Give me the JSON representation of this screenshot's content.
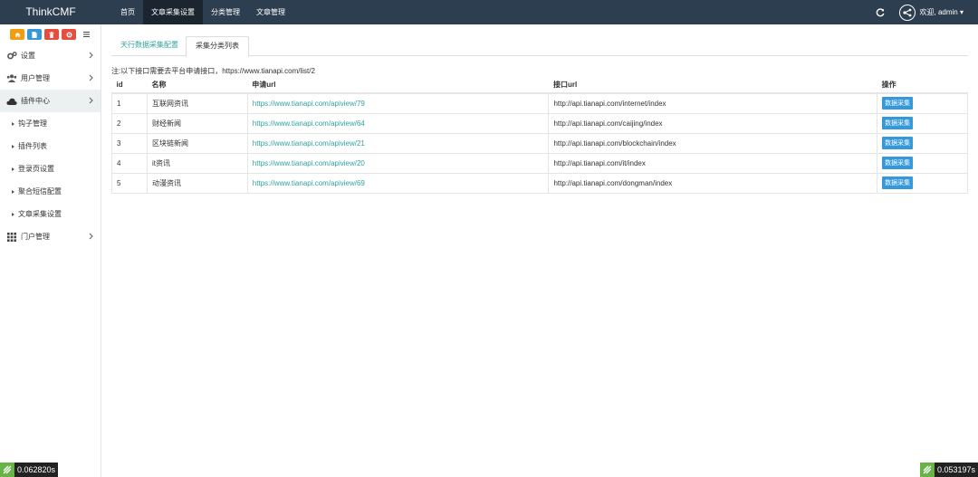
{
  "brand": "ThinkCMF",
  "topnav": [
    {
      "label": "首页"
    },
    {
      "label": "文章采集设置"
    },
    {
      "label": "分类管理"
    },
    {
      "label": "文章管理"
    }
  ],
  "user": {
    "label": "欢迎, admin ▾"
  },
  "sidebar": {
    "menu": [
      {
        "label": "设置",
        "icon": "gears-icon"
      },
      {
        "label": "用户管理",
        "icon": "users-icon"
      },
      {
        "label": "插件中心",
        "icon": "cloud-icon"
      }
    ],
    "submenu": [
      {
        "label": "钩子管理"
      },
      {
        "label": "插件列表"
      },
      {
        "label": "登录页设置"
      },
      {
        "label": "聚合短信配置"
      },
      {
        "label": "文章采集设置"
      }
    ],
    "portal": {
      "label": "门户管理",
      "icon": "grid-icon"
    }
  },
  "tabs": [
    {
      "label": "天行数据采集配置"
    },
    {
      "label": "采集分类列表"
    }
  ],
  "note": "注:以下接口需要去平台申请接口，https://www.tianapi.com/list/2",
  "table": {
    "headers": [
      "id",
      "名称",
      "申请url",
      "接口url",
      "操作"
    ],
    "rows": [
      {
        "id": "1",
        "name": "互联网资讯",
        "apply": "https://www.tianapi.com/apiview/79",
        "api": "http://api.tianapi.com/internet/index",
        "action": "数据采集"
      },
      {
        "id": "2",
        "name": "财经新闻",
        "apply": "https://www.tianapi.com/apiview/64",
        "api": "http://api.tianapi.com/caijing/index",
        "action": "数据采集"
      },
      {
        "id": "3",
        "name": "区块链新闻",
        "apply": "https://www.tianapi.com/apiview/21",
        "api": "http://api.tianapi.com/blockchain/index",
        "action": "数据采集"
      },
      {
        "id": "4",
        "name": "it资讯",
        "apply": "https://www.tianapi.com/apiview/20",
        "api": "http://api.tianapi.com/it/index",
        "action": "数据采集"
      },
      {
        "id": "5",
        "name": "动漫资讯",
        "apply": "https://www.tianapi.com/apiview/69",
        "api": "http://api.tianapi.com/dongman/index",
        "action": "数据采集"
      }
    ]
  },
  "timers": {
    "left": "0.062820s",
    "right": "0.053197s"
  },
  "colors": {
    "navbar": "#2c3e50",
    "accent": "#2fa4a0",
    "button": "#3498db"
  }
}
